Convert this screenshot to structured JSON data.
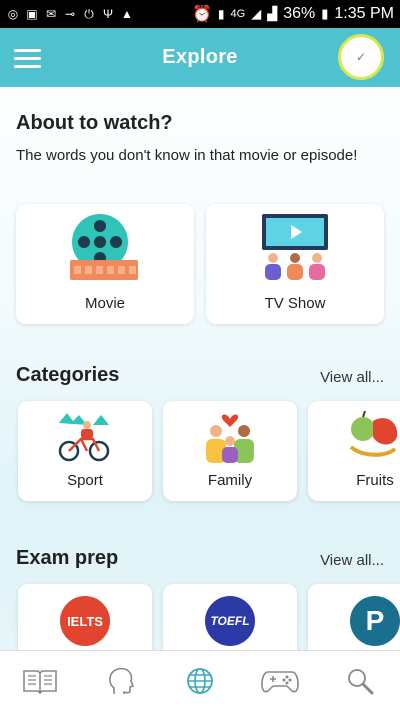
{
  "status_bar": {
    "network": "4G",
    "battery": "36%",
    "time": "1:35 PM"
  },
  "header": {
    "title": "Explore"
  },
  "about": {
    "heading": "About to watch?",
    "subtitle": "The words you don't know in that movie or episode!",
    "cards": [
      {
        "label": "Movie",
        "icon": "film-reel-icon"
      },
      {
        "label": "TV Show",
        "icon": "tv-audience-icon"
      }
    ]
  },
  "categories": {
    "heading": "Categories",
    "view_all": "View all...",
    "items": [
      {
        "label": "Sport",
        "icon": "cycling-icon"
      },
      {
        "label": "Family",
        "icon": "family-icon"
      },
      {
        "label": "Fruits",
        "icon": "fruits-icon"
      }
    ]
  },
  "exam_prep": {
    "heading": "Exam prep",
    "view_all": "View all...",
    "items": [
      {
        "badge": "IELTS",
        "color": "#e2452f"
      },
      {
        "badge": "TOEFL",
        "color": "#2c3aa8"
      },
      {
        "badge": "P",
        "color": "#1a6f8f"
      }
    ]
  },
  "bottom_nav": [
    "book-icon",
    "head-profile-icon",
    "globe-icon",
    "gamepad-icon",
    "search-icon"
  ],
  "colors": {
    "accent": "#4fc1cf",
    "active_nav": "#3aa8b8"
  }
}
